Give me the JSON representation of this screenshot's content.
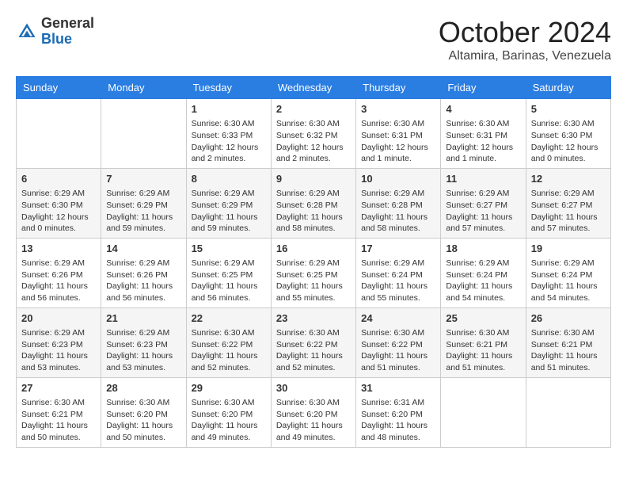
{
  "header": {
    "logo": {
      "general": "General",
      "blue": "Blue"
    },
    "month": "October 2024",
    "location": "Altamira, Barinas, Venezuela"
  },
  "days_of_week": [
    "Sunday",
    "Monday",
    "Tuesday",
    "Wednesday",
    "Thursday",
    "Friday",
    "Saturday"
  ],
  "weeks": [
    [
      {
        "day": "",
        "info": ""
      },
      {
        "day": "",
        "info": ""
      },
      {
        "day": "1",
        "info": "Sunrise: 6:30 AM\nSunset: 6:33 PM\nDaylight: 12 hours and 2 minutes."
      },
      {
        "day": "2",
        "info": "Sunrise: 6:30 AM\nSunset: 6:32 PM\nDaylight: 12 hours and 2 minutes."
      },
      {
        "day": "3",
        "info": "Sunrise: 6:30 AM\nSunset: 6:31 PM\nDaylight: 12 hours and 1 minute."
      },
      {
        "day": "4",
        "info": "Sunrise: 6:30 AM\nSunset: 6:31 PM\nDaylight: 12 hours and 1 minute."
      },
      {
        "day": "5",
        "info": "Sunrise: 6:30 AM\nSunset: 6:30 PM\nDaylight: 12 hours and 0 minutes."
      }
    ],
    [
      {
        "day": "6",
        "info": "Sunrise: 6:29 AM\nSunset: 6:30 PM\nDaylight: 12 hours and 0 minutes."
      },
      {
        "day": "7",
        "info": "Sunrise: 6:29 AM\nSunset: 6:29 PM\nDaylight: 11 hours and 59 minutes."
      },
      {
        "day": "8",
        "info": "Sunrise: 6:29 AM\nSunset: 6:29 PM\nDaylight: 11 hours and 59 minutes."
      },
      {
        "day": "9",
        "info": "Sunrise: 6:29 AM\nSunset: 6:28 PM\nDaylight: 11 hours and 58 minutes."
      },
      {
        "day": "10",
        "info": "Sunrise: 6:29 AM\nSunset: 6:28 PM\nDaylight: 11 hours and 58 minutes."
      },
      {
        "day": "11",
        "info": "Sunrise: 6:29 AM\nSunset: 6:27 PM\nDaylight: 11 hours and 57 minutes."
      },
      {
        "day": "12",
        "info": "Sunrise: 6:29 AM\nSunset: 6:27 PM\nDaylight: 11 hours and 57 minutes."
      }
    ],
    [
      {
        "day": "13",
        "info": "Sunrise: 6:29 AM\nSunset: 6:26 PM\nDaylight: 11 hours and 56 minutes."
      },
      {
        "day": "14",
        "info": "Sunrise: 6:29 AM\nSunset: 6:26 PM\nDaylight: 11 hours and 56 minutes."
      },
      {
        "day": "15",
        "info": "Sunrise: 6:29 AM\nSunset: 6:25 PM\nDaylight: 11 hours and 56 minutes."
      },
      {
        "day": "16",
        "info": "Sunrise: 6:29 AM\nSunset: 6:25 PM\nDaylight: 11 hours and 55 minutes."
      },
      {
        "day": "17",
        "info": "Sunrise: 6:29 AM\nSunset: 6:24 PM\nDaylight: 11 hours and 55 minutes."
      },
      {
        "day": "18",
        "info": "Sunrise: 6:29 AM\nSunset: 6:24 PM\nDaylight: 11 hours and 54 minutes."
      },
      {
        "day": "19",
        "info": "Sunrise: 6:29 AM\nSunset: 6:24 PM\nDaylight: 11 hours and 54 minutes."
      }
    ],
    [
      {
        "day": "20",
        "info": "Sunrise: 6:29 AM\nSunset: 6:23 PM\nDaylight: 11 hours and 53 minutes."
      },
      {
        "day": "21",
        "info": "Sunrise: 6:29 AM\nSunset: 6:23 PM\nDaylight: 11 hours and 53 minutes."
      },
      {
        "day": "22",
        "info": "Sunrise: 6:30 AM\nSunset: 6:22 PM\nDaylight: 11 hours and 52 minutes."
      },
      {
        "day": "23",
        "info": "Sunrise: 6:30 AM\nSunset: 6:22 PM\nDaylight: 11 hours and 52 minutes."
      },
      {
        "day": "24",
        "info": "Sunrise: 6:30 AM\nSunset: 6:22 PM\nDaylight: 11 hours and 51 minutes."
      },
      {
        "day": "25",
        "info": "Sunrise: 6:30 AM\nSunset: 6:21 PM\nDaylight: 11 hours and 51 minutes."
      },
      {
        "day": "26",
        "info": "Sunrise: 6:30 AM\nSunset: 6:21 PM\nDaylight: 11 hours and 51 minutes."
      }
    ],
    [
      {
        "day": "27",
        "info": "Sunrise: 6:30 AM\nSunset: 6:21 PM\nDaylight: 11 hours and 50 minutes."
      },
      {
        "day": "28",
        "info": "Sunrise: 6:30 AM\nSunset: 6:20 PM\nDaylight: 11 hours and 50 minutes."
      },
      {
        "day": "29",
        "info": "Sunrise: 6:30 AM\nSunset: 6:20 PM\nDaylight: 11 hours and 49 minutes."
      },
      {
        "day": "30",
        "info": "Sunrise: 6:30 AM\nSunset: 6:20 PM\nDaylight: 11 hours and 49 minutes."
      },
      {
        "day": "31",
        "info": "Sunrise: 6:31 AM\nSunset: 6:20 PM\nDaylight: 11 hours and 48 minutes."
      },
      {
        "day": "",
        "info": ""
      },
      {
        "day": "",
        "info": ""
      }
    ]
  ]
}
